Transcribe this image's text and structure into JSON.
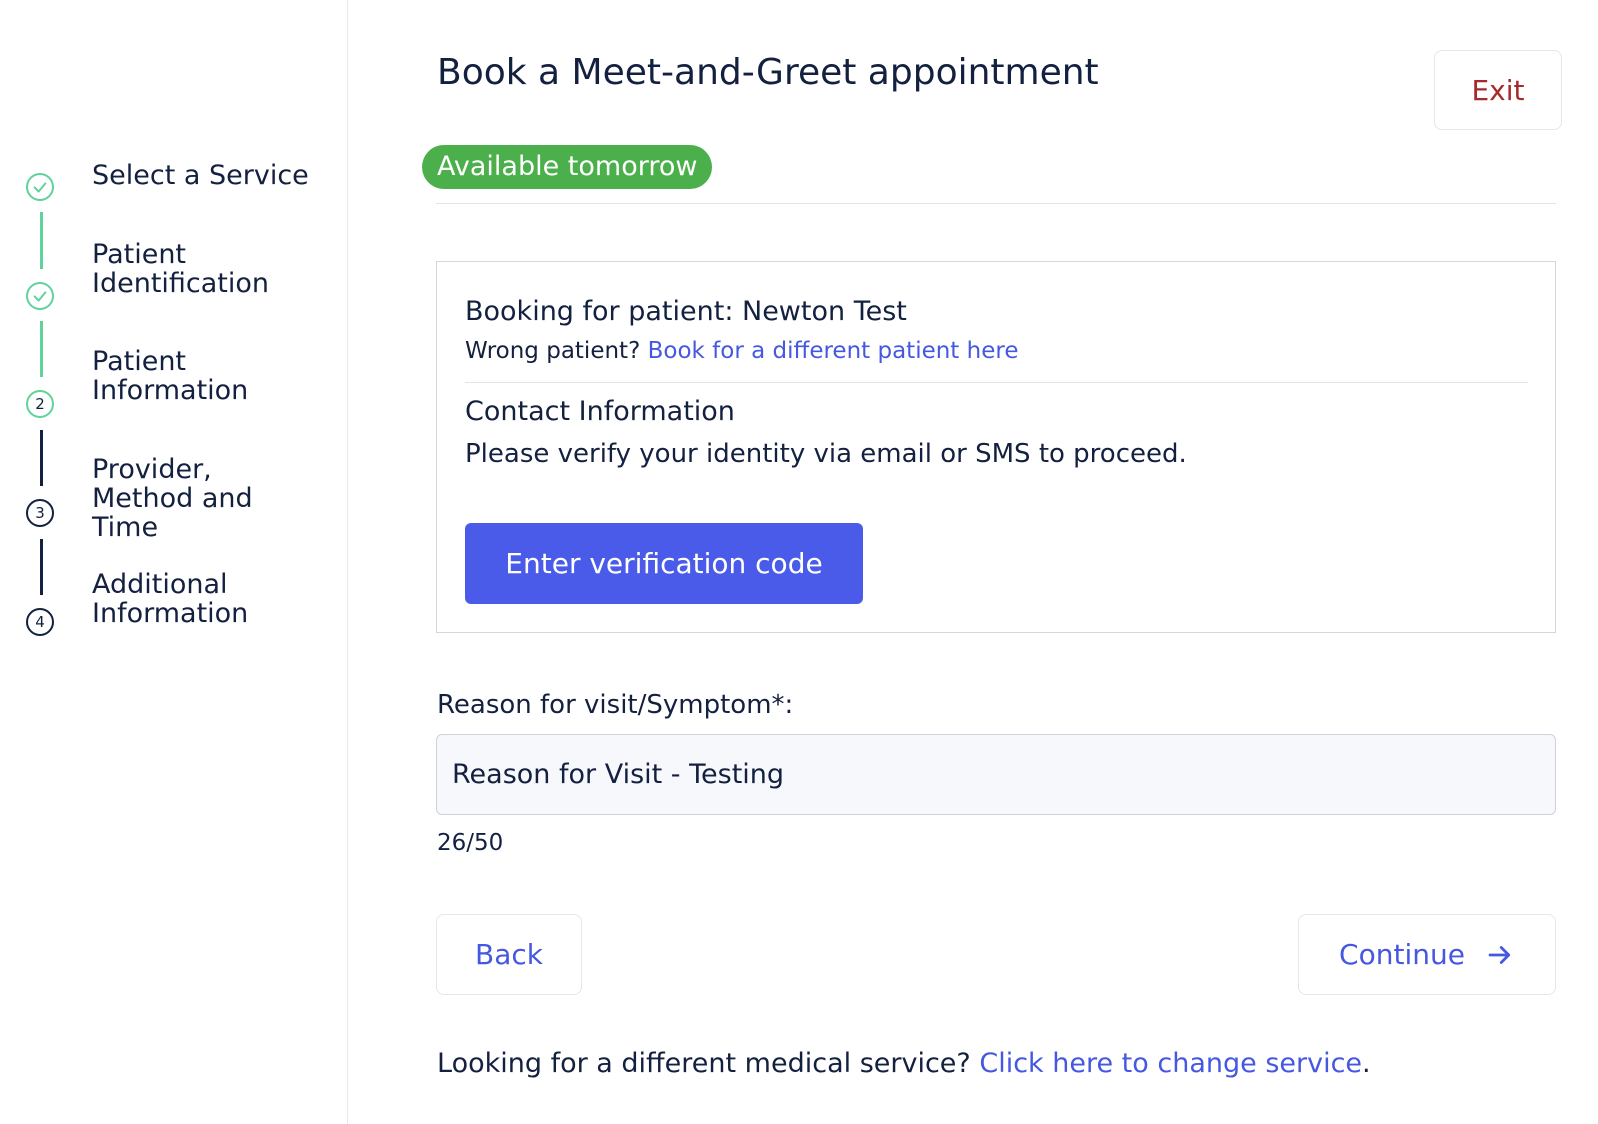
{
  "sidebar": {
    "steps": [
      {
        "label": "Select a Service",
        "status": "complete",
        "icon": "check-icon"
      },
      {
        "label": "Patient Identification",
        "status": "complete",
        "icon": "check-icon"
      },
      {
        "label": "Patient Information",
        "status": "current",
        "number": "2"
      },
      {
        "label": "Provider, Method and Time",
        "status": "upcoming",
        "number": "3"
      },
      {
        "label": "Additional Information",
        "status": "upcoming",
        "number": "4"
      }
    ]
  },
  "header": {
    "title": "Book a Meet-and-Greet appointment",
    "exit_label": "Exit",
    "availability_badge": "Available tomorrow"
  },
  "booking": {
    "patient_label": "Booking for patient: Newton Test",
    "wrong_patient_prompt": "Wrong patient?",
    "wrong_patient_link": "Book for a different patient here",
    "contact_title": "Contact Information",
    "contact_text": "Please verify your identity via email or SMS to proceed.",
    "verify_button": "Enter verification code"
  },
  "reason": {
    "label": "Reason for visit/Symptom*:",
    "value": "Reason for Visit - Testing",
    "counter": "26/50"
  },
  "actions": {
    "back_label": "Back",
    "continue_label": "Continue",
    "continue_icon": "arrow-right-icon"
  },
  "footer": {
    "prompt": "Looking for a different medical service?",
    "link": "Click here to change service",
    "trailing": "."
  },
  "colors": {
    "accent": "#4a5bea",
    "link": "#4658e0",
    "success": "#4bb04b",
    "step_complete": "#5fd39a",
    "exit": "#a62a2a",
    "text": "#13203f"
  }
}
